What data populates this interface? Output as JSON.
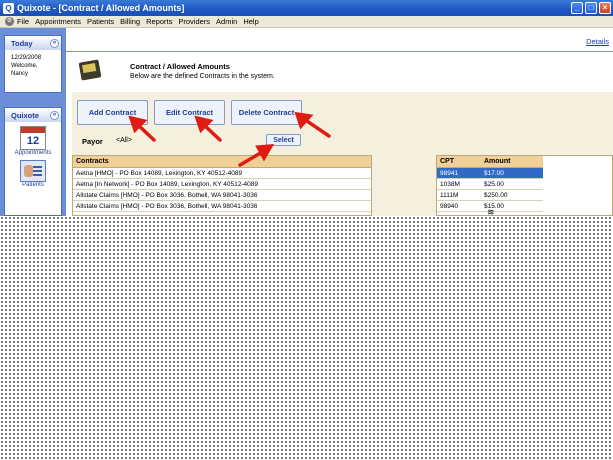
{
  "window": {
    "title": "Quixote - [Contract / Allowed Amounts]",
    "min": "_",
    "max": "□",
    "close": "×"
  },
  "menu": [
    "File",
    "Appointments",
    "Patients",
    "Billing",
    "Reports",
    "Providers",
    "Admin",
    "Help"
  ],
  "sidebar": {
    "today": {
      "title": "Today",
      "date": "12/29/2008",
      "welcome": "Welcome,",
      "user": "Nancy"
    },
    "quixote": {
      "title": "Quixote",
      "items": [
        {
          "label": "Appointments",
          "icon": "calendar-icon",
          "num": "12"
        },
        {
          "label": "Patients",
          "icon": "patients-icon"
        }
      ]
    }
  },
  "main": {
    "details": "Details",
    "header_title": "Contract / Allowed Amounts",
    "header_sub": "Below are the defined Contracts in the system.",
    "buttons": {
      "add": "Add Contract",
      "edit": "Edit Contract",
      "delete": "Delete Contract"
    },
    "payor_label": "Payor",
    "payor_value": "<All>",
    "select": "Select"
  },
  "contracts": {
    "header": "Contracts",
    "rows": [
      "Aetna [HMO] - PO Box 14089, Lexington, KY 40512-4089",
      "Aetna [In Network] - PO Box 14089, Lexington, KY 40512-4089",
      "Allstate Claims [HMO] - PO Box 3036, Bothell, WA 98041-3036",
      "Allstate Claims [HMO] - PO Box 3036, Bothell, WA 98041-3036"
    ]
  },
  "amounts": {
    "headers": [
      "CPT",
      "Amount"
    ],
    "rows": [
      {
        "cpt": "98941",
        "amount": "$17.00"
      },
      {
        "cpt": "1038M",
        "amount": "$25.00"
      },
      {
        "cpt": "1111M",
        "amount": "$250.00"
      },
      {
        "cpt": "98940",
        "amount": "$15.00"
      }
    ]
  },
  "colors": {
    "accent": "#1f57c3",
    "arrow": "#e01b12",
    "selected_row": "#3169c6"
  }
}
